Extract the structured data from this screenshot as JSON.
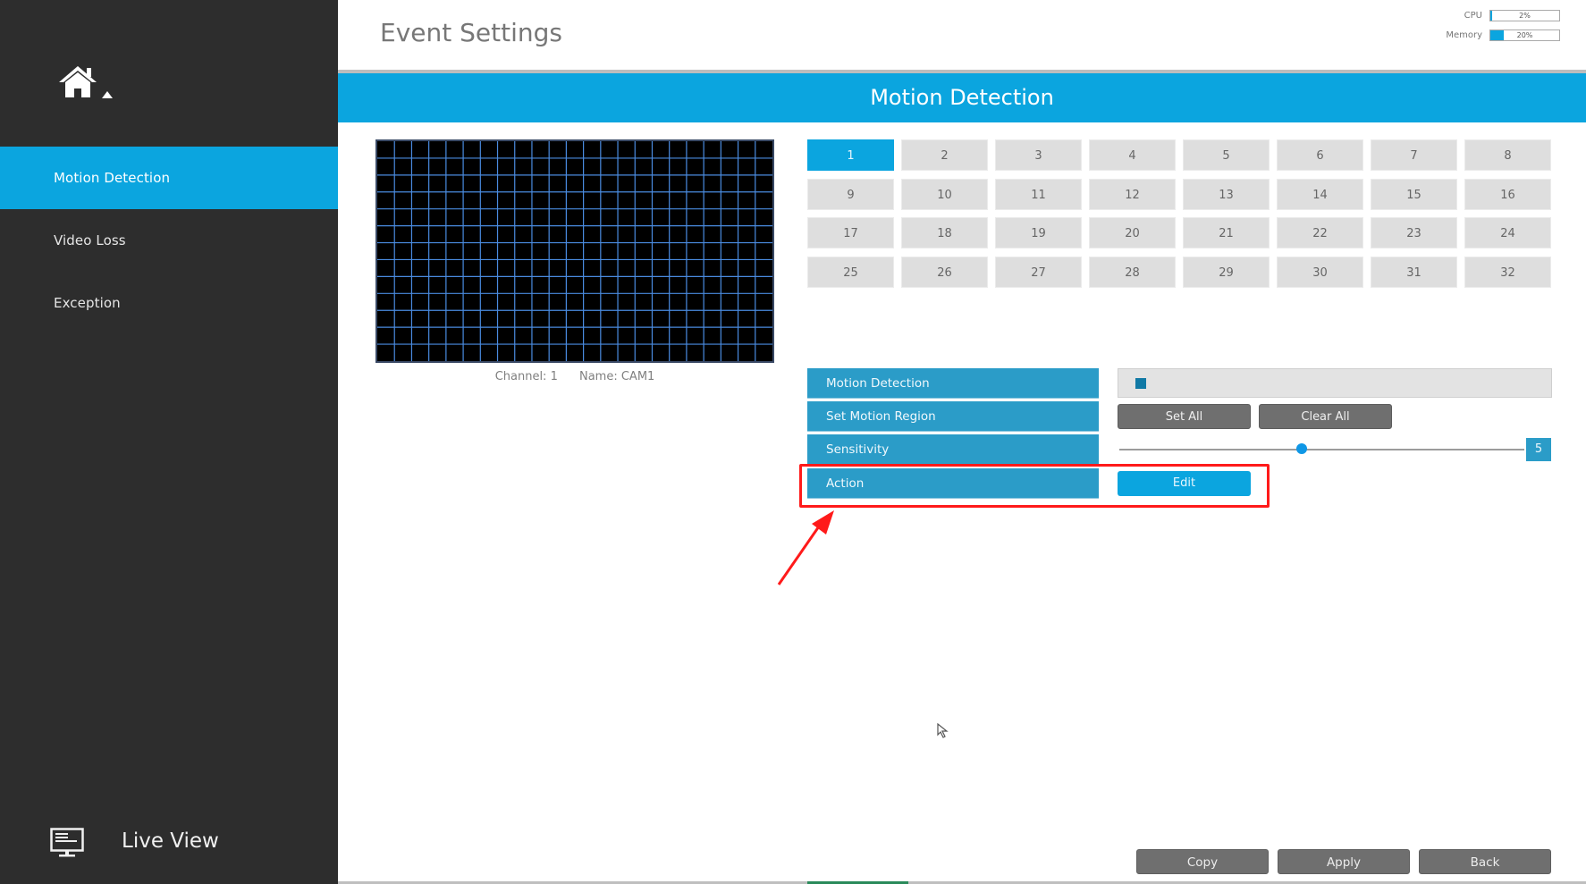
{
  "header": {
    "title": "Event Settings",
    "meters": [
      {
        "label": "CPU",
        "value_text": "2%",
        "fraction": 0.02
      },
      {
        "label": "Memory",
        "value_text": "20%",
        "fraction": 0.2
      }
    ]
  },
  "sidebar": {
    "home_icon": "home-icon",
    "items": [
      {
        "label": "Motion Detection",
        "active": true
      },
      {
        "label": "Video Loss",
        "active": false
      },
      {
        "label": "Exception",
        "active": false
      }
    ],
    "live_view": {
      "label": "Live View",
      "icon": "monitor-icon"
    }
  },
  "section": {
    "title": "Motion Detection"
  },
  "preview": {
    "grid_columns": 23,
    "grid_rows": 13,
    "grid_color": "#4a8be0",
    "channel_label": "Channel: 1",
    "name_label": "Name: CAM1"
  },
  "channels": {
    "selected": "1",
    "items": [
      "1",
      "2",
      "3",
      "4",
      "5",
      "6",
      "7",
      "8",
      "9",
      "10",
      "11",
      "12",
      "13",
      "14",
      "15",
      "16",
      "17",
      "18",
      "19",
      "20",
      "21",
      "22",
      "23",
      "24",
      "25",
      "26",
      "27",
      "28",
      "29",
      "30",
      "31",
      "32"
    ]
  },
  "settings": {
    "motion_detection": {
      "label": "Motion Detection",
      "enabled": true
    },
    "set_motion_region": {
      "label": "Set Motion Region",
      "set_all": "Set All",
      "clear_all": "Clear All"
    },
    "sensitivity": {
      "label": "Sensitivity",
      "value": "5",
      "min": 1,
      "max": 10,
      "fraction": 0.45
    },
    "action": {
      "label": "Action",
      "edit": "Edit"
    }
  },
  "footer": {
    "copy": "Copy",
    "apply": "Apply",
    "back": "Back"
  },
  "colors": {
    "accent": "#0ba5df",
    "label_bg": "#2b9cc8",
    "sidebar_bg": "#2d2d2d",
    "button_gray": "#6f6f6f",
    "annotation_red": "#ff1a1a"
  }
}
